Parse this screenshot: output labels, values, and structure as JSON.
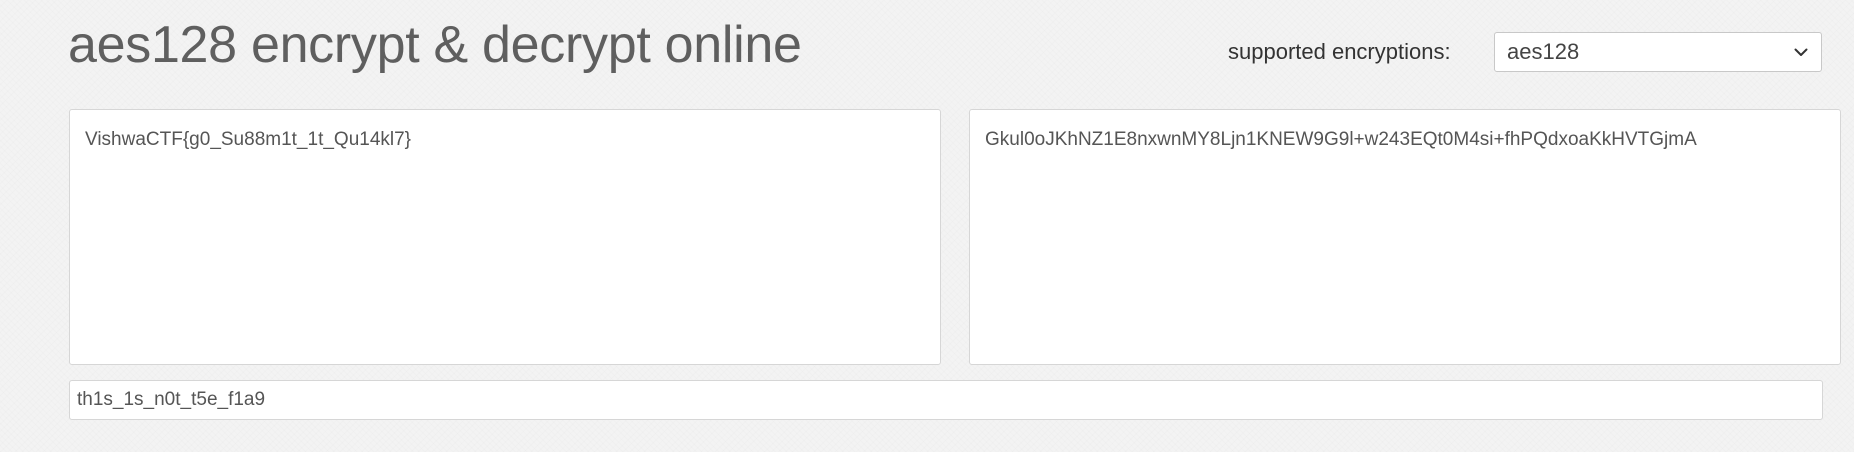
{
  "header": {
    "title": "aes128 encrypt & decrypt online"
  },
  "encryption_selector": {
    "label": "supported encryptions:",
    "selected": "aes128"
  },
  "plaintext": {
    "value": "VishwaCTF{g0_Su88m1t_1t_Qu14kl7}"
  },
  "ciphertext": {
    "value": "Gkul0oJKhNZ1E8nxwnMY8Ljn1KNEW9G9l+w243EQt0M4si+fhPQdxoaKkHVTGjmA"
  },
  "key": {
    "value": "th1s_1s_n0t_t5e_f1a9"
  },
  "icons": {
    "dropdown": "chevron-down-icon"
  },
  "colors": {
    "background": "#f3f3f3",
    "title": "#5f5f5f",
    "text": "#555555",
    "field_border": "#d6d6d6"
  }
}
